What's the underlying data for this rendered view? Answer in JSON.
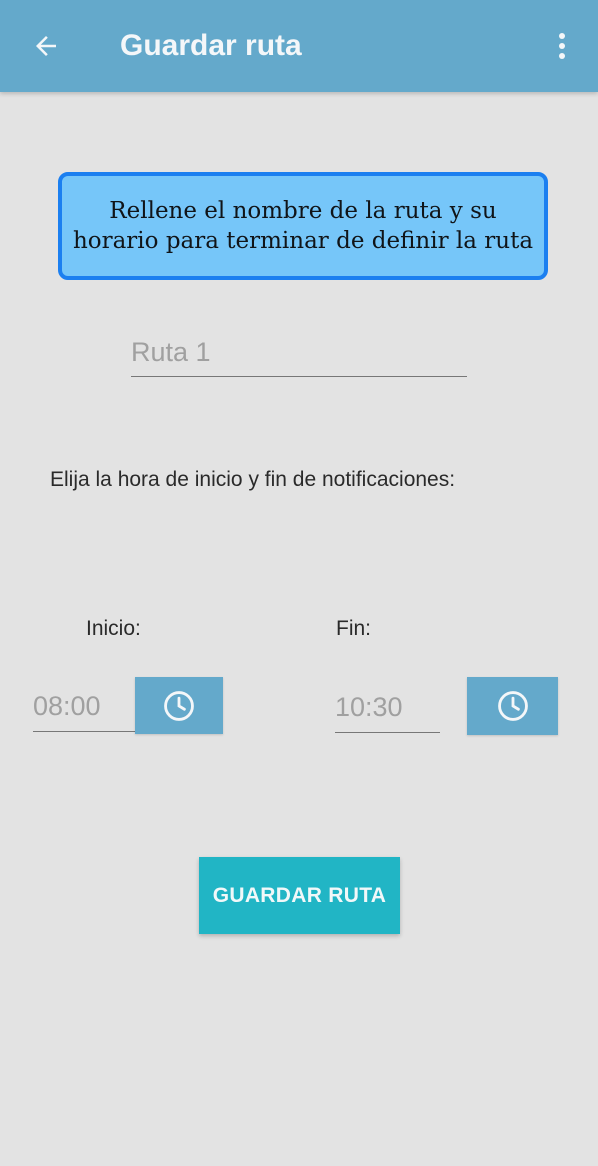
{
  "appbar": {
    "title": "Guardar ruta",
    "back_icon": "arrow-left-icon",
    "menu_icon": "more-vertical-icon",
    "color": "#64a9cb"
  },
  "info": {
    "text": "Rellene el nombre de la ruta y su horario para terminar de definir la ruta",
    "background": "#76c6f9",
    "border_color": "#1b7ff0"
  },
  "route_name": {
    "value": "",
    "placeholder": "Ruta 1"
  },
  "instructions": "Elija la hora de inicio y fin de notificaciones:",
  "start": {
    "label": "Inicio:",
    "value": "",
    "placeholder": "08:00",
    "button_icon": "clock-icon"
  },
  "end": {
    "label": "Fin:",
    "value": "",
    "placeholder": "10:30",
    "button_icon": "clock-icon"
  },
  "save_button": {
    "label": "GUARDAR RUTA",
    "color": "#21b5c5"
  }
}
